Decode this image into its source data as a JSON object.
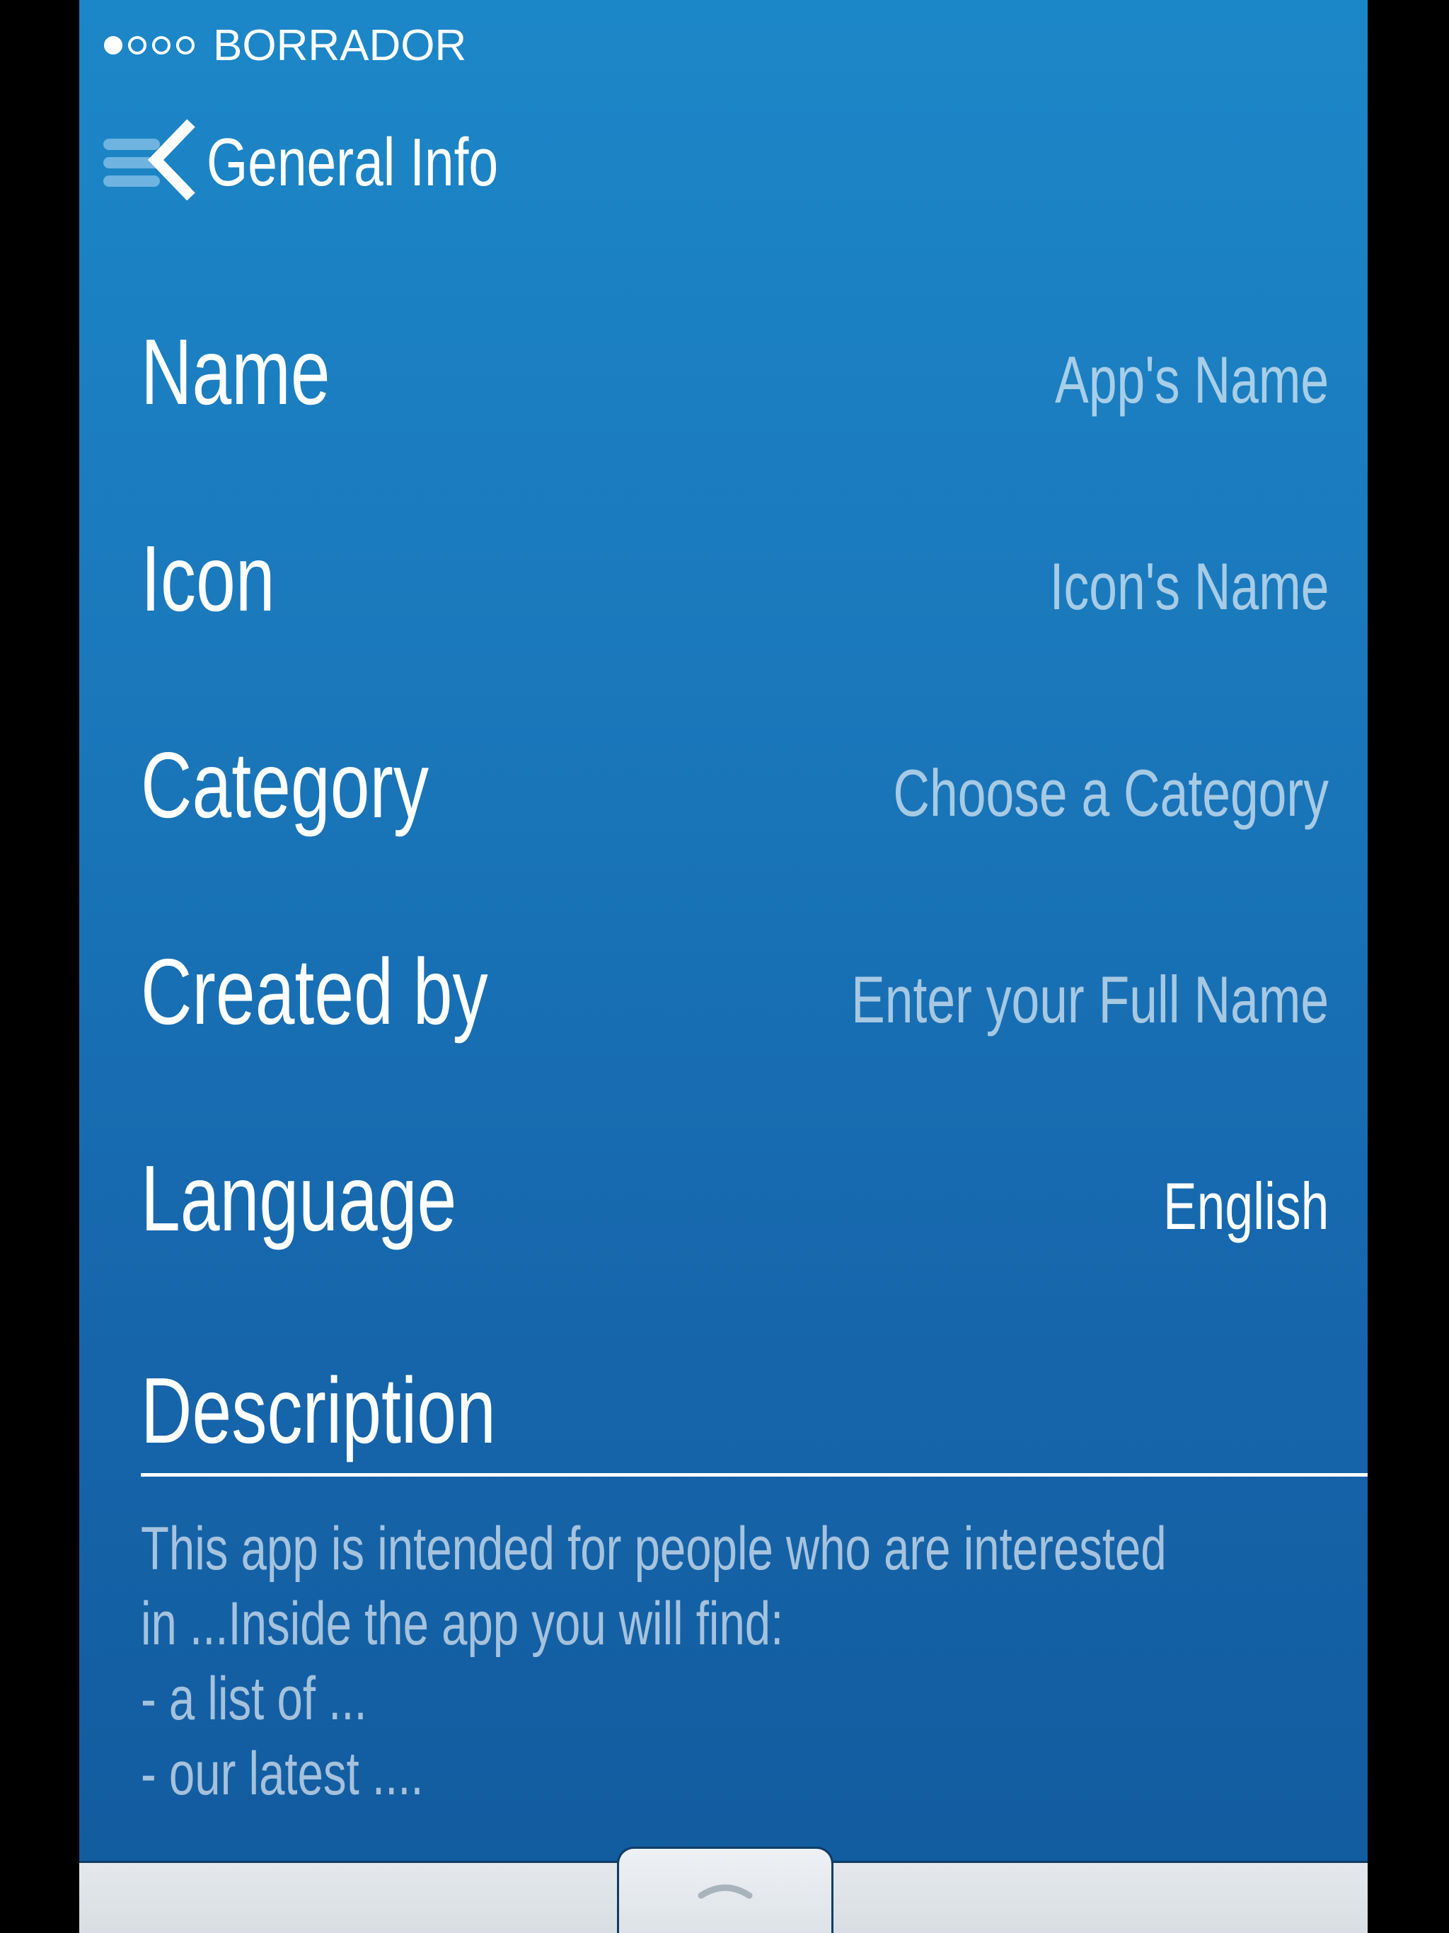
{
  "status_bar": {
    "signal_dots": [
      "filled",
      "empty",
      "empty",
      "empty",
      "empty"
    ],
    "carrier": "BORRADOR"
  },
  "nav": {
    "title": "General Info",
    "icon": "menu-back-icon"
  },
  "rows": [
    {
      "label": "Name",
      "value": "App's Name",
      "is_placeholder": true
    },
    {
      "label": "Icon",
      "value": "Icon's Name",
      "is_placeholder": true
    },
    {
      "label": "Category",
      "value": "Choose a Category",
      "is_placeholder": true
    },
    {
      "label": "Created by",
      "value": "Enter your Full Name",
      "is_placeholder": true
    },
    {
      "label": "Language",
      "value": "English",
      "is_placeholder": false
    }
  ],
  "description": {
    "heading": "Description",
    "lines": [
      "This app is intended for people who are interested",
      "in ...Inside the app you will find:",
      "- a list of ...",
      "- our latest ...."
    ]
  },
  "tray": {
    "icon": "chevron-up-icon"
  },
  "colors": {
    "background_top": "#1c87c8",
    "background_bottom": "#125a9e",
    "text": "#ffffff",
    "placeholder": "rgba(255,255,255,0.62)",
    "tray": "#e4e8ec"
  }
}
